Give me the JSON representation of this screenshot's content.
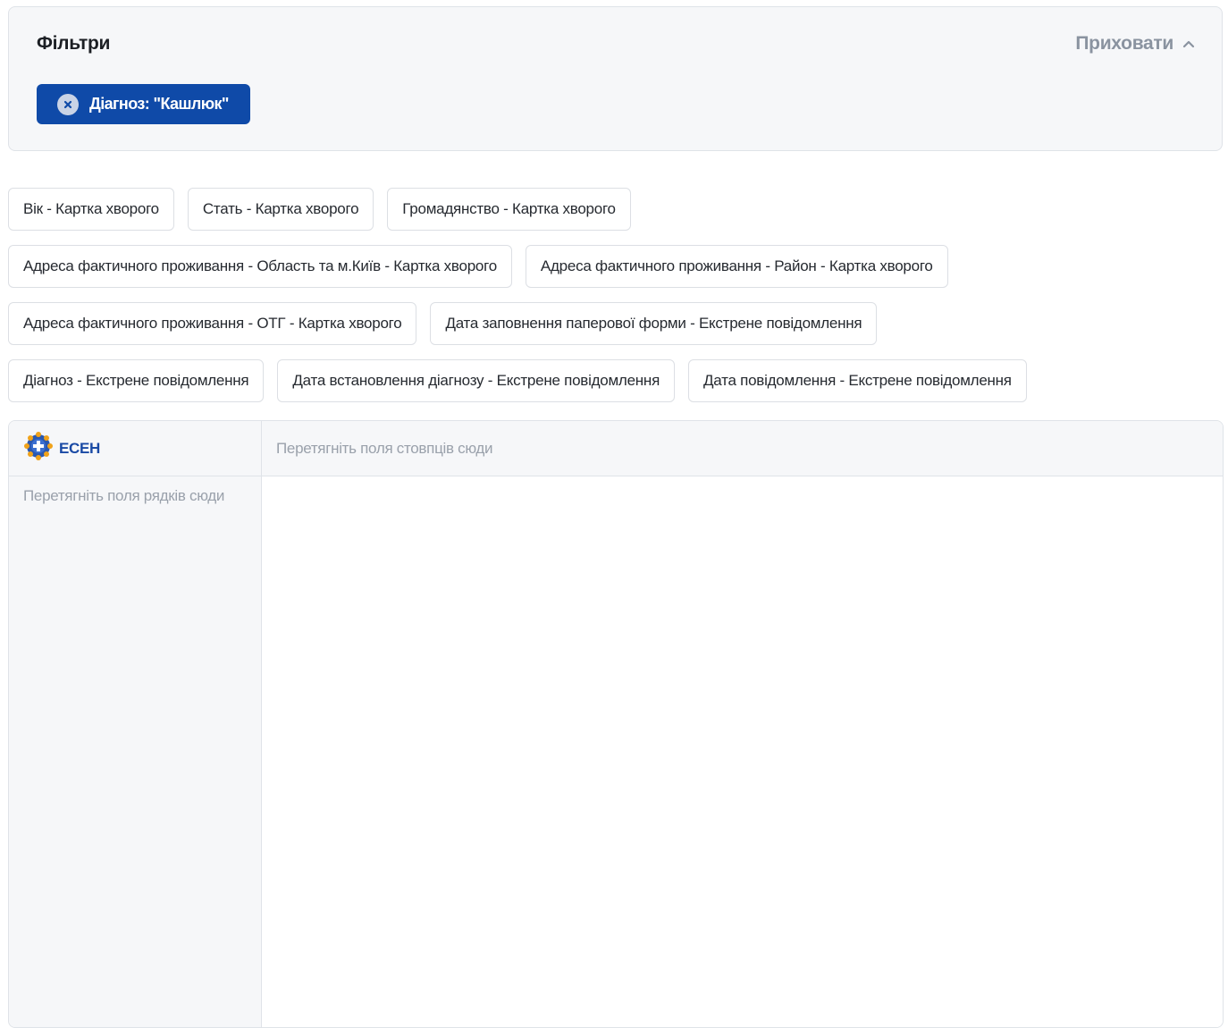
{
  "filters": {
    "title": "Фільтри",
    "hide_label": "Приховати",
    "active_filters": [
      {
        "label": "Діагноз: \"Кашлюк\""
      }
    ]
  },
  "fields": {
    "row1": [
      "Вік - Картка хворого",
      "Стать - Картка хворого",
      "Громадянство - Картка хворого"
    ],
    "row2": [
      "Адреса фактичного проживання - Область та м.Київ - Картка хворого",
      "Адреса фактичного проживання - Район - Картка хворого"
    ],
    "row3": [
      "Адреса фактичного проживання - ОТГ - Картка хворого",
      "Дата заповнення паперової форми - Екстрене повідомлення"
    ],
    "row4": [
      "Діагноз - Екстрене повідомлення",
      "Дата встановлення діагнозу - Екстрене повідомлення",
      "Дата повідомлення - Екстрене повідомлення"
    ]
  },
  "pivot": {
    "logo_text": "ЕСЕН",
    "columns_placeholder": "Перетягніть поля стовпців сюди",
    "rows_placeholder": "Перетягніть поля рядків сюди"
  },
  "colors": {
    "chip_bg": "#0f4aa8",
    "panel_bg": "#f6f7f9",
    "border": "#dfe3e8",
    "muted_text": "#9aa1ab"
  }
}
